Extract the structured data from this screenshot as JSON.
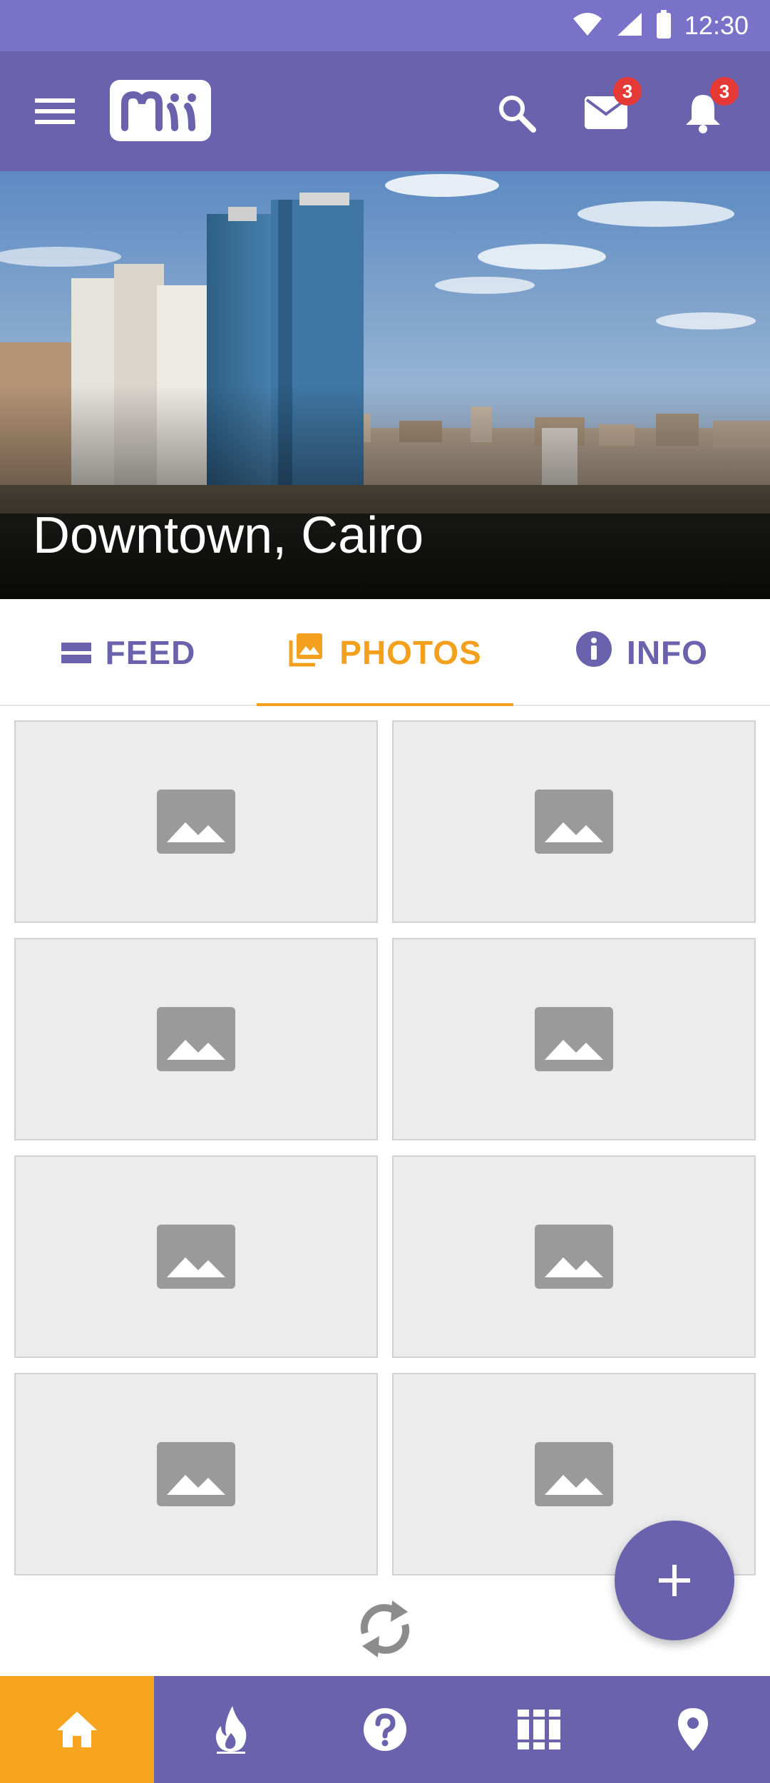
{
  "status_bar": {
    "time": "12:30",
    "icons": [
      "wifi-icon",
      "signal-icon",
      "battery-icon"
    ]
  },
  "app_bar": {
    "menu_icon": "hamburger-menu-icon",
    "logo": "Mii",
    "actions": [
      {
        "name": "search-icon"
      },
      {
        "name": "mail-icon",
        "badge": "3"
      },
      {
        "name": "bell-icon",
        "badge": "3"
      }
    ]
  },
  "hero": {
    "title": "Downtown, Cairo"
  },
  "tabs": [
    {
      "label": "FEED",
      "icon": "feed-icon",
      "active": false
    },
    {
      "label": "PHOTOS",
      "icon": "photos-icon",
      "active": true
    },
    {
      "label": "INFO",
      "icon": "info-icon",
      "active": false
    }
  ],
  "photo_grid": {
    "count": 8,
    "placeholder_icon": "image-placeholder-icon"
  },
  "fab": {
    "icon": "plus-icon"
  },
  "refresh": {
    "icon": "refresh-icon"
  },
  "bottom_nav": [
    {
      "icon": "home-icon",
      "active": true
    },
    {
      "icon": "flame-icon",
      "active": false
    },
    {
      "icon": "question-icon",
      "active": false
    },
    {
      "icon": "library-icon",
      "active": false
    },
    {
      "icon": "location-pin-icon",
      "active": false
    }
  ],
  "colors": {
    "primary": "#6a62ad",
    "status_bar": "#7a71c9",
    "accent": "#f2a01d",
    "badge": "#e53935"
  }
}
